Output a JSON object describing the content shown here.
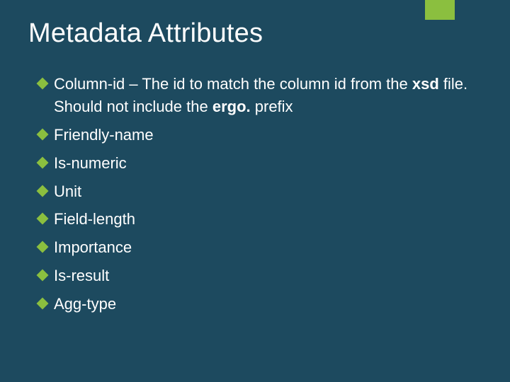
{
  "accent_color": "#8bbf3f",
  "background_color": "#1d4a5f",
  "title": "Metadata Attributes",
  "bullets": [
    {
      "lead": "Column-id",
      "rest_1": " – The id to match the column id from the ",
      "bold_1": "xsd",
      "rest_2": " file. Should not include the ",
      "bold_2": "ergo.",
      "rest_3": " prefix"
    },
    {
      "lead": "Friendly-name"
    },
    {
      "lead": "Is-numeric"
    },
    {
      "lead": "Unit"
    },
    {
      "lead": "Field-length"
    },
    {
      "lead": "Importance"
    },
    {
      "lead": "Is-result"
    },
    {
      "lead": "Agg-type"
    }
  ]
}
